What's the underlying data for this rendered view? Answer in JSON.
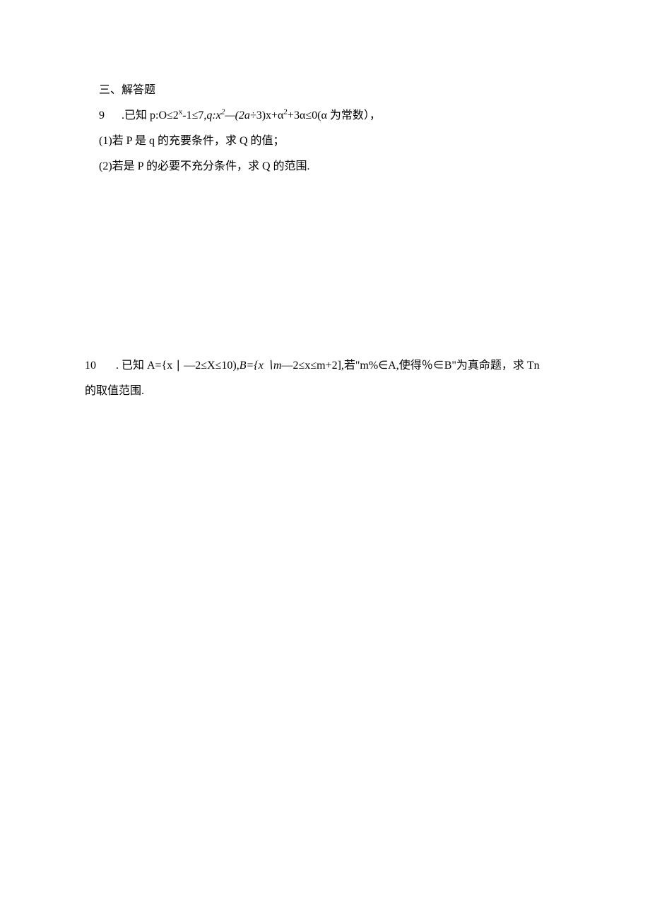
{
  "section_title": "三、解答题",
  "q9": {
    "num": "9",
    "dot": " .",
    "main_a": "已知 p:O≤2",
    "main_sup1": "x",
    "main_b": "-1≤7,",
    "main_c": "q:x",
    "main_sup2": "2",
    "main_d": "—(2a÷",
    "main_e": "3)x+α",
    "main_sup3": "2",
    "main_f": "+3α≤0(α 为常数），",
    "sub1": "(1)若 P 是 q 的充要条件，求 Q 的值；",
    "sub2": "(2)若是 P 的必要不充分条件，求 Q 的范围."
  },
  "q10": {
    "num": "10",
    "dot": " .  ",
    "line1_a": "已知 A={x ∣ —2≤X≤10),",
    "line1_b": "B={x ∖m",
    "line1_c": "—2≤x≤m+2],若\"m%∈A,使得％∈B\"为真命题，求 Tn",
    "line2": "的取值范围."
  }
}
